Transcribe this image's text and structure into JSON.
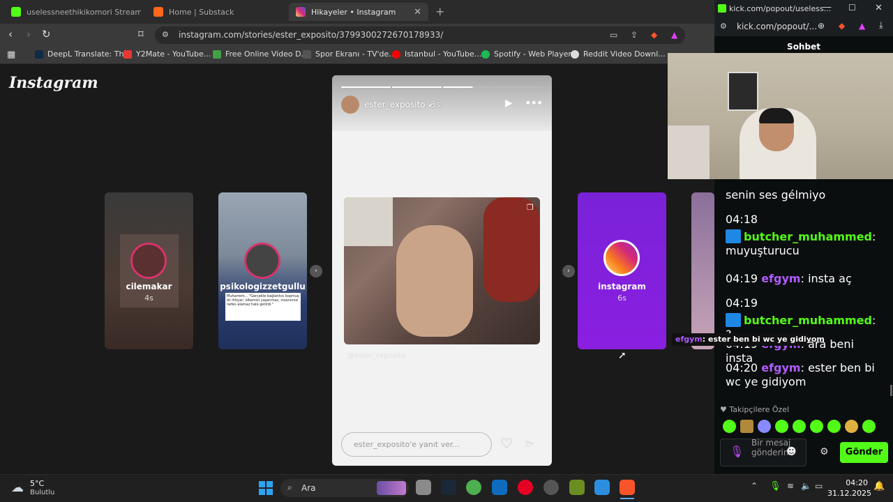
{
  "tabs": [
    {
      "title": "uselessneethikikomori Stream - V",
      "favicon_color": "#53fc18"
    },
    {
      "title": "Home | Substack",
      "favicon_color": "#ff6719"
    },
    {
      "title": "Hikayeler • Instagram",
      "favicon_color": "#d6336c"
    }
  ],
  "address": {
    "url": "instagram.com/stories/ester_exposito/3799300272670178933/"
  },
  "bookmarks": [
    {
      "label": "DeepL Translate: Th...",
      "color": "#0f2b46"
    },
    {
      "label": "Y2Mate - YouTube...",
      "color": "#e53935"
    },
    {
      "label": "Free Online Video D...",
      "color": "#43a047"
    },
    {
      "label": "Spor Ekranı - TV'de...",
      "color": "#555555"
    },
    {
      "label": "Istanbul - YouTube...",
      "color": "#ff0000"
    },
    {
      "label": "Spotify - Web Player...",
      "color": "#1db954"
    },
    {
      "label": "Reddit Video Downl...",
      "color": "#dddddd"
    }
  ],
  "instagram": {
    "logo": "Instagram",
    "side_stories": [
      {
        "name": "cilemakar",
        "time": "4s"
      },
      {
        "name": "psikologizzetgullu",
        "time": "",
        "caption": "Muharrem... \"Gerçekle bağlantısı kopmuş iki ihtiyar; ülkemizi yaşanmaz, insanımızı nefes alamaz hale getirdi.\""
      },
      {
        "name": "instagram",
        "time": "6s"
      }
    ],
    "story": {
      "username": "ester_exposito",
      "time": "3s",
      "watermark": "@ester_exposito",
      "reply_placeholder": "ester_exposito'e yanıt ver..."
    }
  },
  "kick": {
    "tab_title": "kick.com/popout/useless...",
    "url": "kick.com/popout/...",
    "chat_title": "Sohbet",
    "messages": [
      {
        "time": "",
        "user": "",
        "text": "senin ses gélmiyo"
      },
      {
        "time": "04:18",
        "user": "butcher_muhammed",
        "text": "muyuşturucu"
      },
      {
        "time": "04:19",
        "user": "efgym",
        "text": "insta aç"
      },
      {
        "time": "04:19",
        "user": "butcher_muhammed",
        "text": "?"
      },
      {
        "time": "04:19",
        "user": "efgym",
        "text": "ara beni insta"
      },
      {
        "time": "04:20",
        "user": "efgym",
        "text": "ester ben bi wc ye gidiyom"
      }
    ],
    "overlay": {
      "user": "efgym",
      "text": ": ester ben bi wc ye gidiyom"
    },
    "followers_label": "Takipçilere Özel",
    "message_placeholder": "Bir mesaj gönderin",
    "send_label": "Gönder"
  },
  "taskbar": {
    "weather_temp": "5°C",
    "weather_desc": "Bulutlu",
    "search_placeholder": "Ara",
    "time": "04:20",
    "date": "31.12.2025"
  }
}
